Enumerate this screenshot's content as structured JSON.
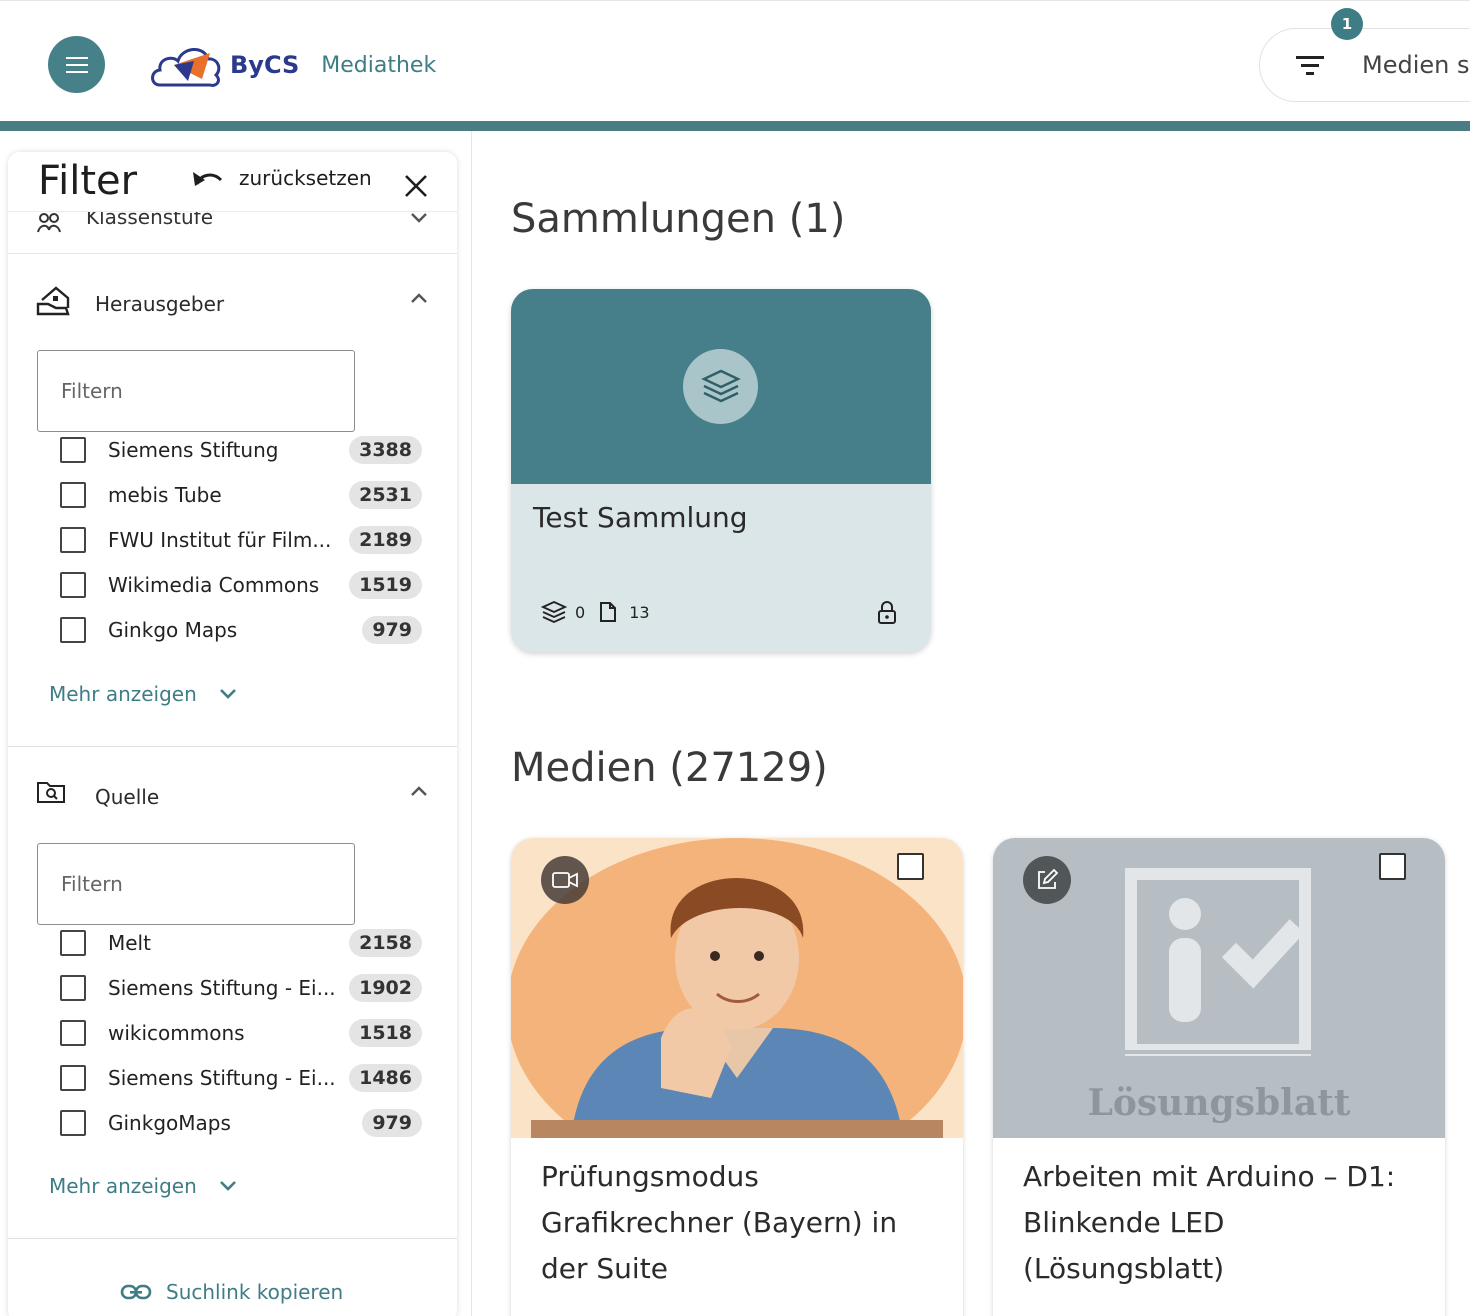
{
  "header": {
    "brand": "ByCS",
    "product": "Mediathek",
    "search_text": "Medien s",
    "filter_badge": "1"
  },
  "sidebar": {
    "title": "Filter",
    "reset_label": "zurücksetzen",
    "klassenstufe_label": "Klassenstufe",
    "publisher": {
      "label": "Herausgeber",
      "filter_placeholder": "Filtern",
      "options": [
        {
          "label": "Siemens Stiftung",
          "count": "3388"
        },
        {
          "label": "mebis Tube",
          "count": "2531"
        },
        {
          "label": "FWU Institut für Film...",
          "count": "2189"
        },
        {
          "label": "Wikimedia Commons",
          "count": "1519"
        },
        {
          "label": "Ginkgo Maps",
          "count": "979"
        }
      ],
      "more_label": "Mehr anzeigen"
    },
    "source": {
      "label": "Quelle",
      "filter_placeholder": "Filtern",
      "options": [
        {
          "label": "Melt",
          "count": "2158"
        },
        {
          "label": "Siemens Stiftung - Ei...",
          "count": "1902"
        },
        {
          "label": "wikicommons",
          "count": "1518"
        },
        {
          "label": "Siemens Stiftung - Ei...",
          "count": "1486"
        },
        {
          "label": "GinkgoMaps",
          "count": "979"
        }
      ],
      "more_label": "Mehr anzeigen"
    },
    "copy_link_label": "Suchlink kopieren"
  },
  "main": {
    "collections_heading": "Sammlungen (1)",
    "collection": {
      "title": "Test Sammlung",
      "sub_collections": "0",
      "items": "13"
    },
    "media_heading": "Medien (27129)",
    "media": [
      {
        "title": "Prüfungsmodus Grafikrechner (Bayern) in der Suite",
        "type_icon": "video-icon"
      },
      {
        "title": "Arbeiten mit Arduino – D1: Blinkende LED (Lösungsblatt)",
        "type_icon": "edit-icon",
        "thumb_text": "Lösungsblatt"
      }
    ]
  }
}
